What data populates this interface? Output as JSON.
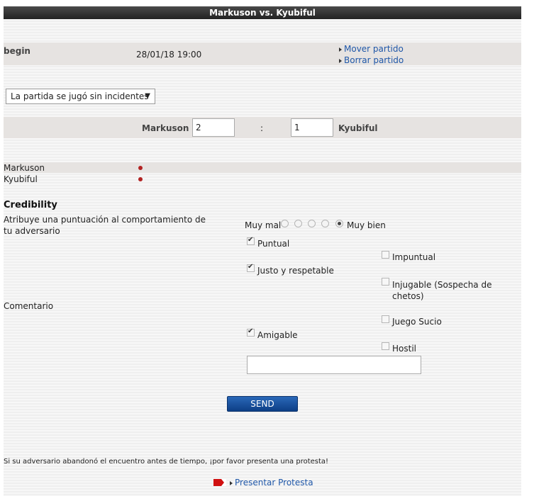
{
  "title": "Markuson vs. Kyubiful",
  "match": {
    "label": "begin",
    "datetime": "28/01/18 19:00",
    "actions": [
      "Mover partido",
      "Borrar partido"
    ]
  },
  "result_select": {
    "selected": "La partida se jugó sin incidentes"
  },
  "score": {
    "home": "Markuson",
    "home_value": "2",
    "separator": ":",
    "away_value": "1",
    "away": "Kyubiful"
  },
  "players": [
    "Markuson",
    "Kyubiful"
  ],
  "credibility": {
    "heading": "Credibility",
    "prompt": "Atribuye una puntuación al comportamiento de tu adversario",
    "rating_low": "Muy mal",
    "rating_high": "Muy bien",
    "selected_rating": 5,
    "comment_label": "Comentario",
    "positive": [
      {
        "label": "Puntual",
        "checked": true
      },
      {
        "label": "Justo y respetable",
        "checked": true
      },
      {
        "label": "Amigable",
        "checked": true
      }
    ],
    "negative": [
      {
        "label": "Impuntual",
        "checked": false
      },
      {
        "label": "Injugable (Sospecha de chetos)",
        "checked": false
      },
      {
        "label": "Juego Sucio",
        "checked": false
      },
      {
        "label": "Hostil",
        "checked": false
      }
    ],
    "comment_value": ""
  },
  "send_label": "SEND",
  "protest": {
    "notice": "Si su adversario abandonó el encuentro antes de tiempo, ¡por favor presenta una protesta!",
    "link": "Presentar Protesta"
  },
  "colors": {
    "link": "#1f57a8",
    "dot": "#b22222",
    "button": "#1a4f9c"
  }
}
